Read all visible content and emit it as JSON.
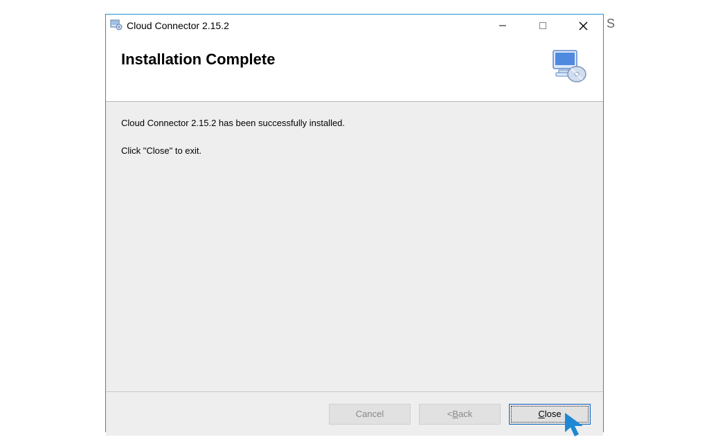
{
  "window": {
    "title": "Cloud Connector 2.15.2"
  },
  "header": {
    "heading": "Installation Complete"
  },
  "body": {
    "line1": "Cloud Connector 2.15.2 has been successfully installed.",
    "line2": "Click \"Close\" to exit."
  },
  "footer": {
    "cancel": "Cancel",
    "back_prefix": "< ",
    "back_u": "B",
    "back_rest": "ack",
    "close_u": "C",
    "close_rest": "lose"
  },
  "stray": "S"
}
